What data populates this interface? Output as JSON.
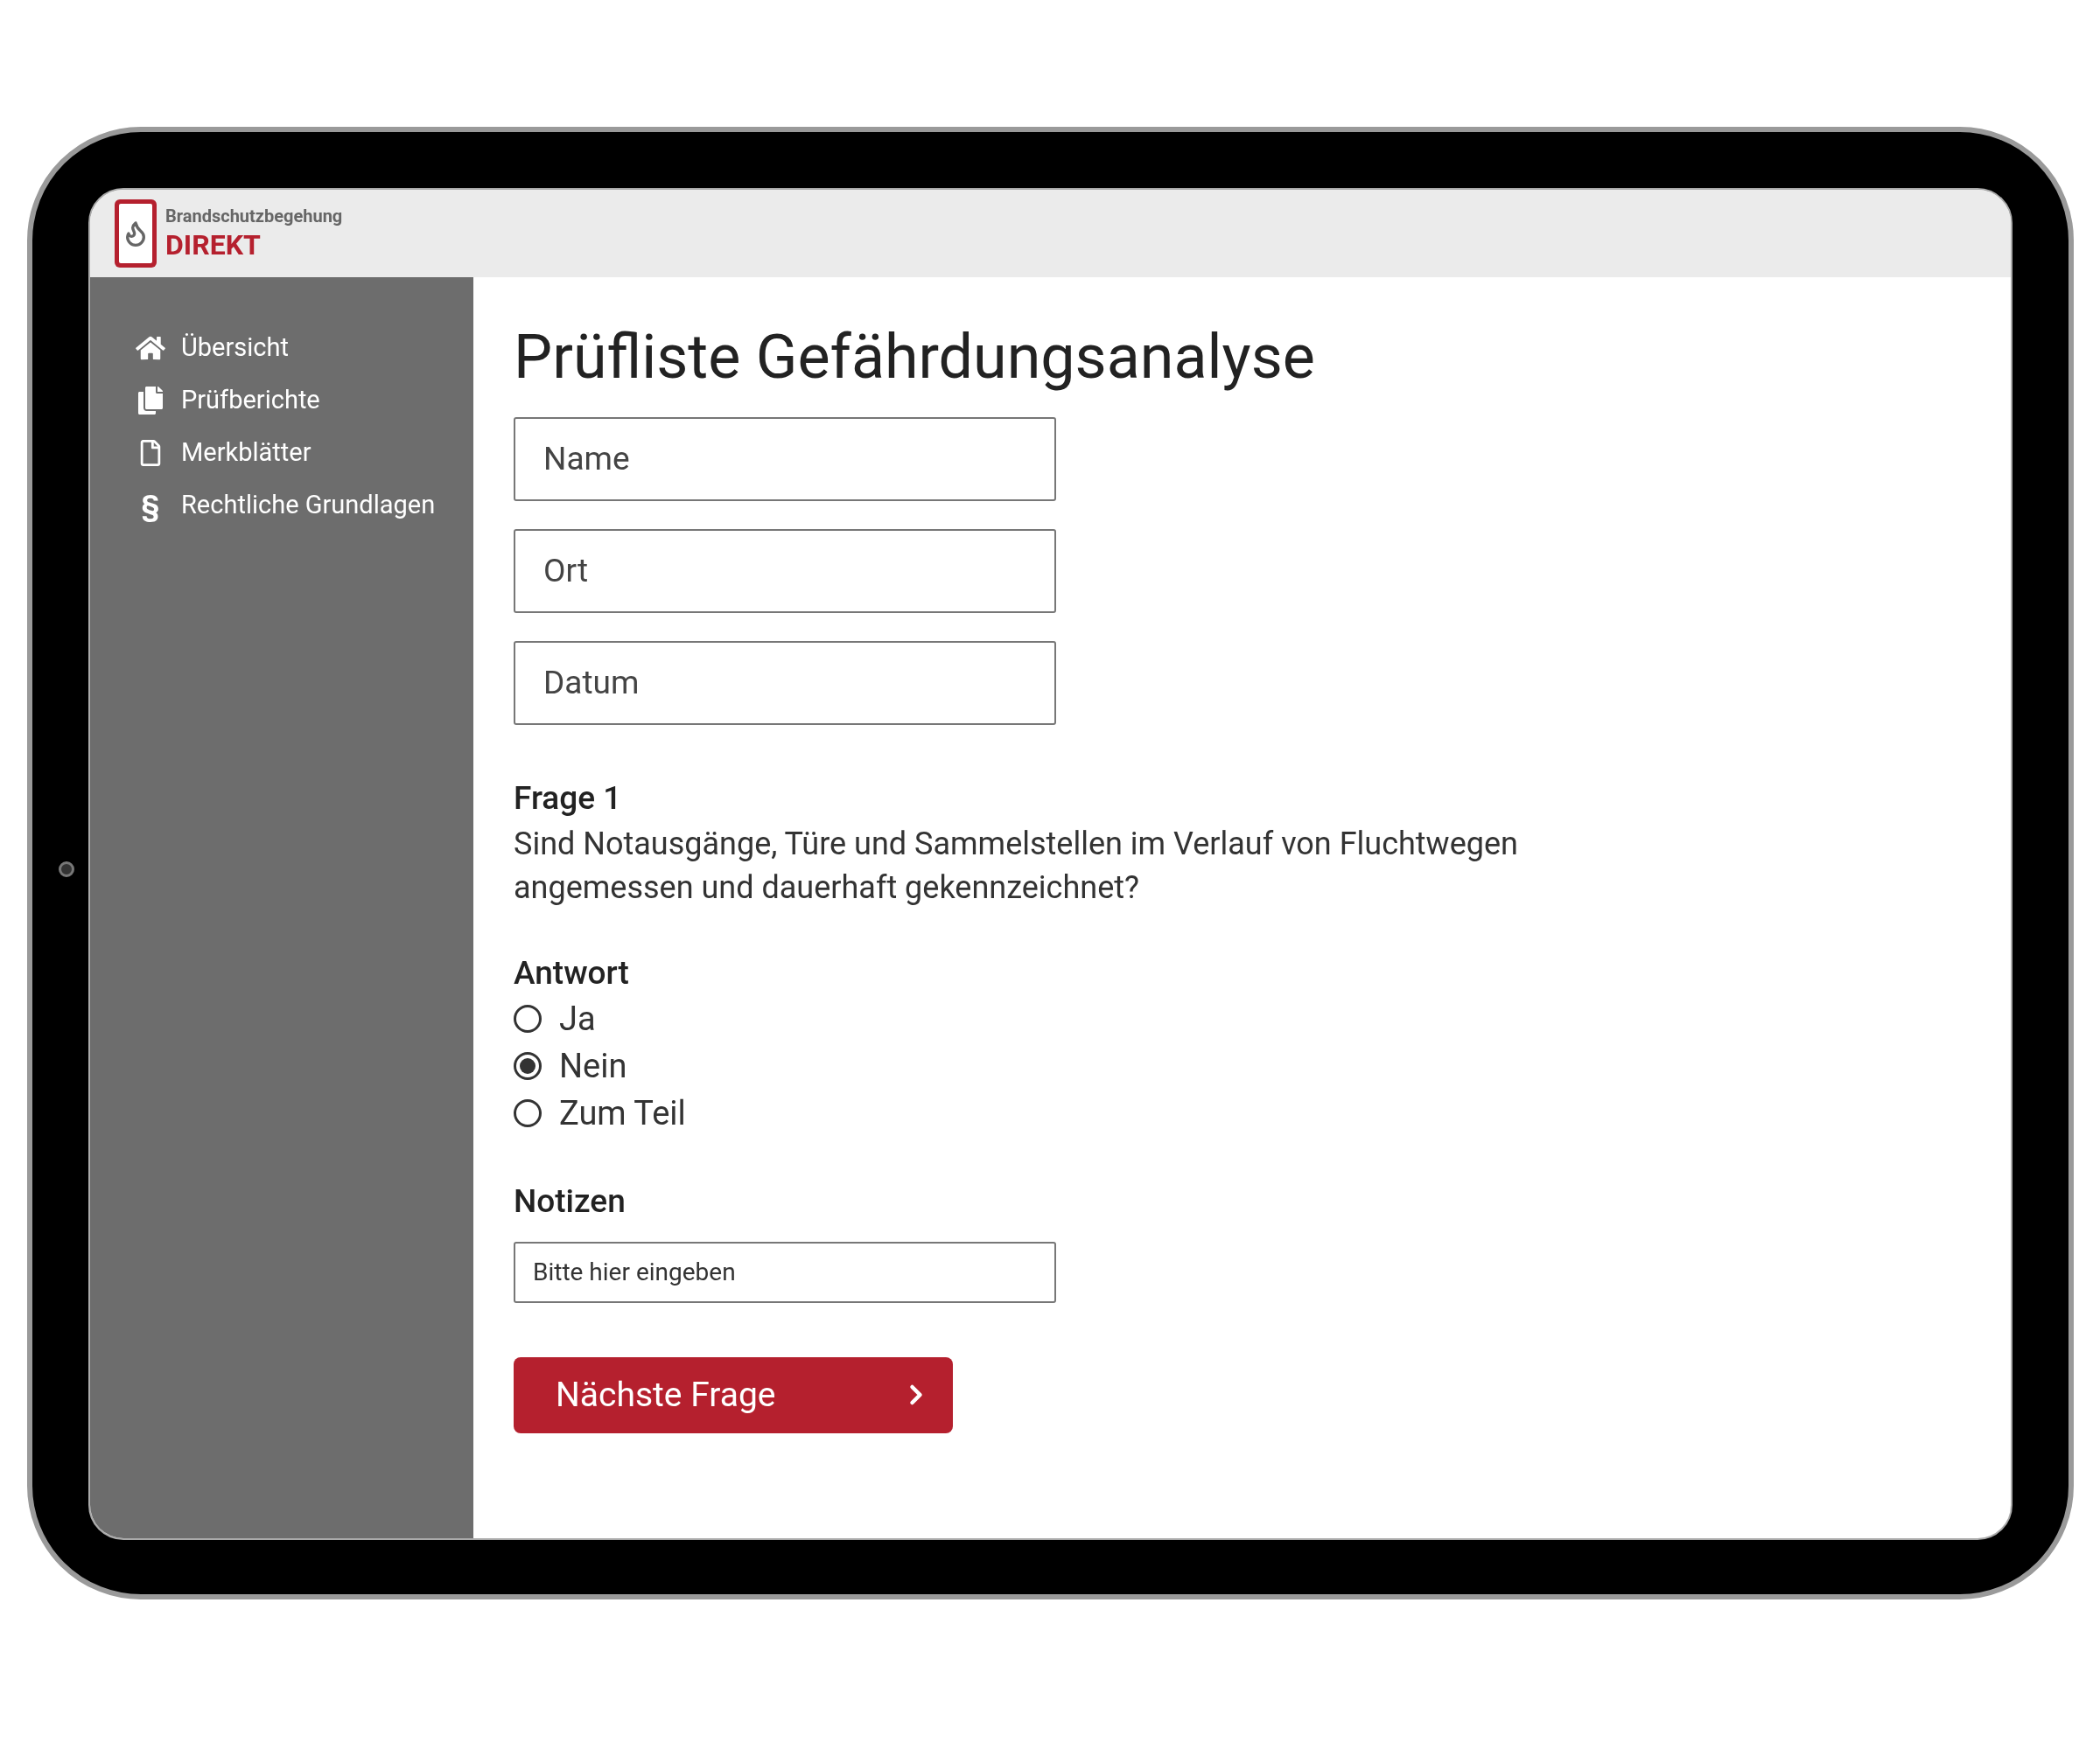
{
  "header": {
    "brand_line": "Brandschutzbegehung",
    "brand_name": "DIREKT"
  },
  "sidebar": {
    "items": [
      {
        "kind": "home",
        "label": "Übersicht"
      },
      {
        "kind": "copies",
        "label": "Prüfberichte"
      },
      {
        "kind": "file",
        "label": "Merkblätter"
      },
      {
        "kind": "glyph",
        "icon": "§",
        "label": "Rechtliche Grundlagen"
      }
    ]
  },
  "title": "Prüfliste Gefährdungsanalyse",
  "fields": [
    {
      "placeholder": "Name"
    },
    {
      "placeholder": "Ort"
    },
    {
      "placeholder": "Datum"
    }
  ],
  "question": {
    "label": "Frage 1",
    "text": "Sind Notausgänge, Türe und Sammelstellen im Verlauf von Fluchtwegen angemessen und dauerhaft gekennzeichnet?"
  },
  "answer": {
    "label": "Antwort",
    "options": [
      {
        "label": "Ja",
        "selected": false
      },
      {
        "label": "Nein",
        "selected": true
      },
      {
        "label": "Zum Teil",
        "selected": false
      }
    ]
  },
  "notes": {
    "label": "Notizen",
    "placeholder": "Bitte hier eingeben"
  },
  "next_button": {
    "label": "Nächste Frage"
  }
}
